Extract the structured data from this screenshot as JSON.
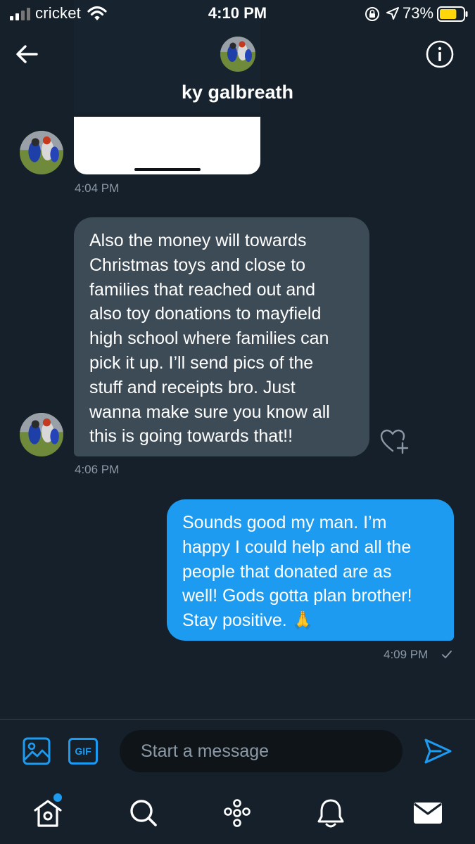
{
  "status_bar": {
    "carrier": "cricket",
    "time": "4:10 PM",
    "battery_percent": "73%",
    "battery_level": 0.73,
    "battery_color": "#ffd60a"
  },
  "header": {
    "contact_name": "ky galbreath",
    "back_icon": "arrow-left-icon",
    "info_icon": "info-icon"
  },
  "messages": [
    {
      "direction": "incoming",
      "type": "media",
      "time": "4:04 PM"
    },
    {
      "direction": "incoming",
      "type": "text",
      "lines": [
        "Also the money will towards",
        "Christmas toys and close to",
        "families that reached out and",
        "also toy donations to mayfield",
        "high school where families can",
        "pick it up. I’ll send pics of the",
        "stuff and receipts bro. Just",
        "wanna make sure you know all",
        "this is going towards that!!"
      ],
      "time": "4:06 PM"
    },
    {
      "direction": "outgoing",
      "type": "text",
      "lines": [
        "Sounds good my man. I’m",
        "happy I could help and all the",
        "people that donated are as",
        "well! Gods gotta plan brother!",
        "Stay positive. 🙏"
      ],
      "time": "4:09 PM",
      "status_icon": "checkmark-icon"
    }
  ],
  "composer": {
    "placeholder": "Start a message",
    "gif_label": "GIF"
  },
  "bottom_nav": {
    "items": [
      "home-icon",
      "search-icon",
      "spaces-icon",
      "notifications-icon",
      "messages-icon"
    ],
    "active": "messages-icon"
  },
  "colors": {
    "background": "#15202b",
    "incoming_bubble": "#3d4b57",
    "outgoing_bubble": "#1d9bf0",
    "accent": "#1d9bf0",
    "muted_text": "#8b98a5"
  }
}
